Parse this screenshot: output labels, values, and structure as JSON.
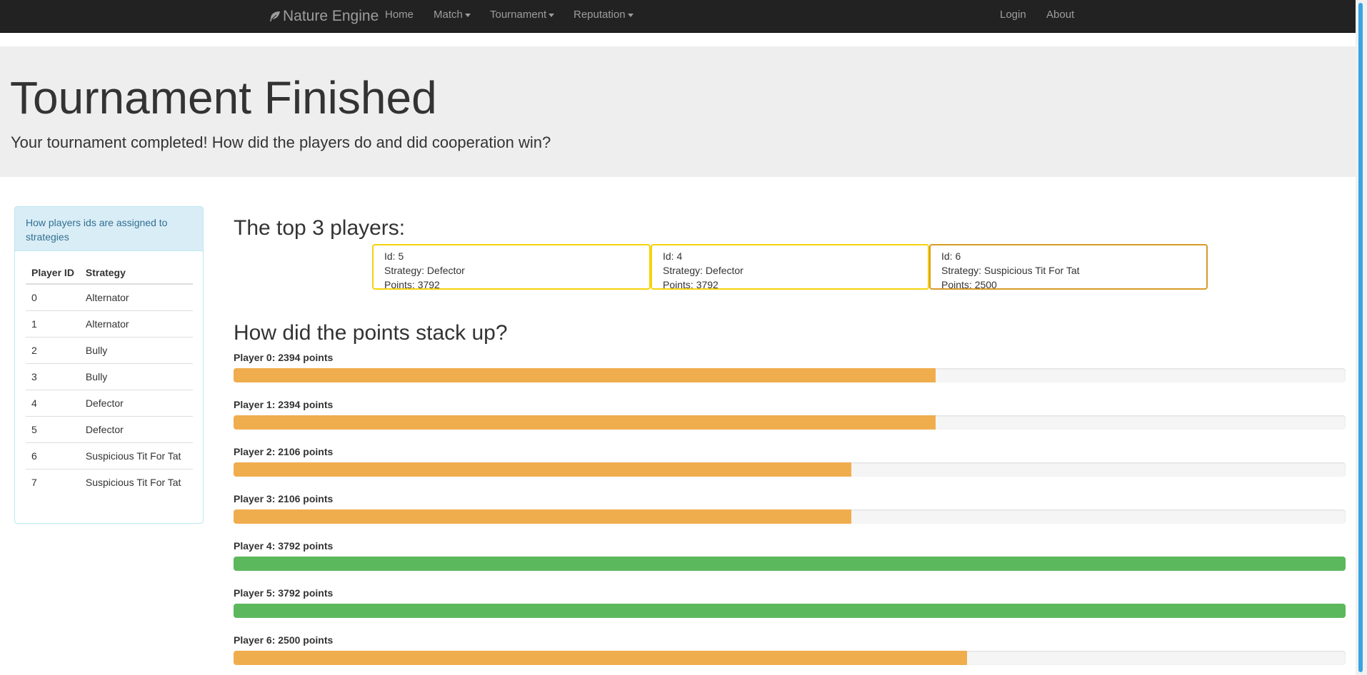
{
  "nav": {
    "brand": "Nature Engine",
    "brand_icon": "leaf-icon",
    "items": [
      "Home",
      "Match",
      "Tournament",
      "Reputation"
    ],
    "right_items": [
      "Login",
      "About"
    ]
  },
  "hero": {
    "title": "Tournament Finished",
    "subtitle": "Your tournament completed! How did the players do and did cooperation win?"
  },
  "sidebar": {
    "heading": "How players ids are assigned to strategies",
    "columns": [
      "Player ID",
      "Strategy"
    ],
    "rows": [
      [
        "0",
        "Alternator"
      ],
      [
        "1",
        "Alternator"
      ],
      [
        "2",
        "Bully"
      ],
      [
        "3",
        "Bully"
      ],
      [
        "4",
        "Defector"
      ],
      [
        "5",
        "Defector"
      ],
      [
        "6",
        "Suspicious Tit For Tat"
      ],
      [
        "7",
        "Suspicious Tit For Tat"
      ]
    ]
  },
  "top_players": {
    "title": "The top 3 players:",
    "cards": [
      {
        "id": "Id: 5",
        "strategy": "Strategy: Defector",
        "points": "Points: 3792"
      },
      {
        "id": "Id: 4",
        "strategy": "Strategy: Defector",
        "points": "Points: 3792"
      },
      {
        "id": "Id: 6",
        "strategy": "Strategy: Suspicious Tit For Tat",
        "points": "Points: 2500"
      }
    ]
  },
  "points": {
    "title": "How did the points stack up?",
    "max_points": 3792,
    "bars": [
      {
        "label": "Player 0: 2394 points",
        "value": 2394
      },
      {
        "label": "Player 1: 2394 points",
        "value": 2394
      },
      {
        "label": "Player 2: 2106 points",
        "value": 2106
      },
      {
        "label": "Player 3: 2106 points",
        "value": 2106
      },
      {
        "label": "Player 4: 3792 points",
        "value": 3792
      },
      {
        "label": "Player 5: 3792 points",
        "value": 3792
      },
      {
        "label": "Player 6: 2500 points",
        "value": 2500
      }
    ]
  },
  "colors": {
    "navbar": "#222222",
    "bar_default": "#f0ad4e",
    "bar_top": "#5cb85c",
    "gold_border": "#f5d20d",
    "bronze_border": "#d99a28"
  }
}
